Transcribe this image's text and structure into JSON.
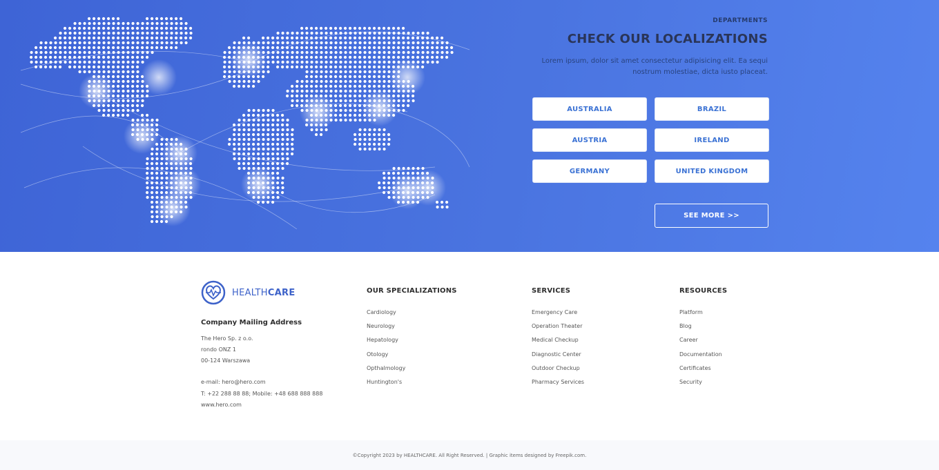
{
  "hero": {
    "eyebrow": "DEPARTMENTS",
    "title": "CHECK OUR LOCALIZATIONS",
    "description": "Lorem ipsum, dolor sit amet consectetur adipisicing elit. Ea sequi nostrum molestiae, dicta iusto placeat.",
    "locations": [
      "AUSTRALIA",
      "BRAZIL",
      "AUSTRIA",
      "IRELAND",
      "GERMANY",
      "UNITED KINGDOM"
    ],
    "see_more_label": "SEE MORE  >>"
  },
  "brand": {
    "name_light": "HEALTH",
    "name_bold": "CARE",
    "icon": "heart-pulse-icon"
  },
  "address": {
    "heading": "Company Mailing Address",
    "lines": [
      "The Hero Sp. z o.o.",
      "rondo ONZ 1",
      "00-124 Warszawa"
    ],
    "email": "e-mail: hero@hero.com",
    "phone": "T: +22 288 88 88; Mobile: +48 688 888 888",
    "website": "www.hero.com"
  },
  "columns": [
    {
      "heading": "OUR SPECIALIZATIONS",
      "items": [
        "Cardiology",
        "Neurology",
        "Hepatology",
        "Otology",
        "Opthalmology",
        "Huntington's"
      ]
    },
    {
      "heading": "SERVICES",
      "items": [
        "Emergency Care",
        "Operation Theater",
        "Medical Checkup",
        "Diagnostic Center",
        "Outdoor Checkup",
        "Pharmacy Services"
      ]
    },
    {
      "heading": "RESOURCES",
      "items": [
        "Platform",
        "Blog",
        "Career",
        "Documentation",
        "Certificates",
        "Security"
      ]
    }
  ],
  "copyright": "©Copyright 2023 by HEALTHCARE. All Right Reserved. | Graphic items designed by Freepik.com.",
  "colors": {
    "hero_gradient_start": "#3e64d6",
    "hero_gradient_end": "#5583ee",
    "button_text": "#3b72d4",
    "brand": "#3d62c9"
  }
}
